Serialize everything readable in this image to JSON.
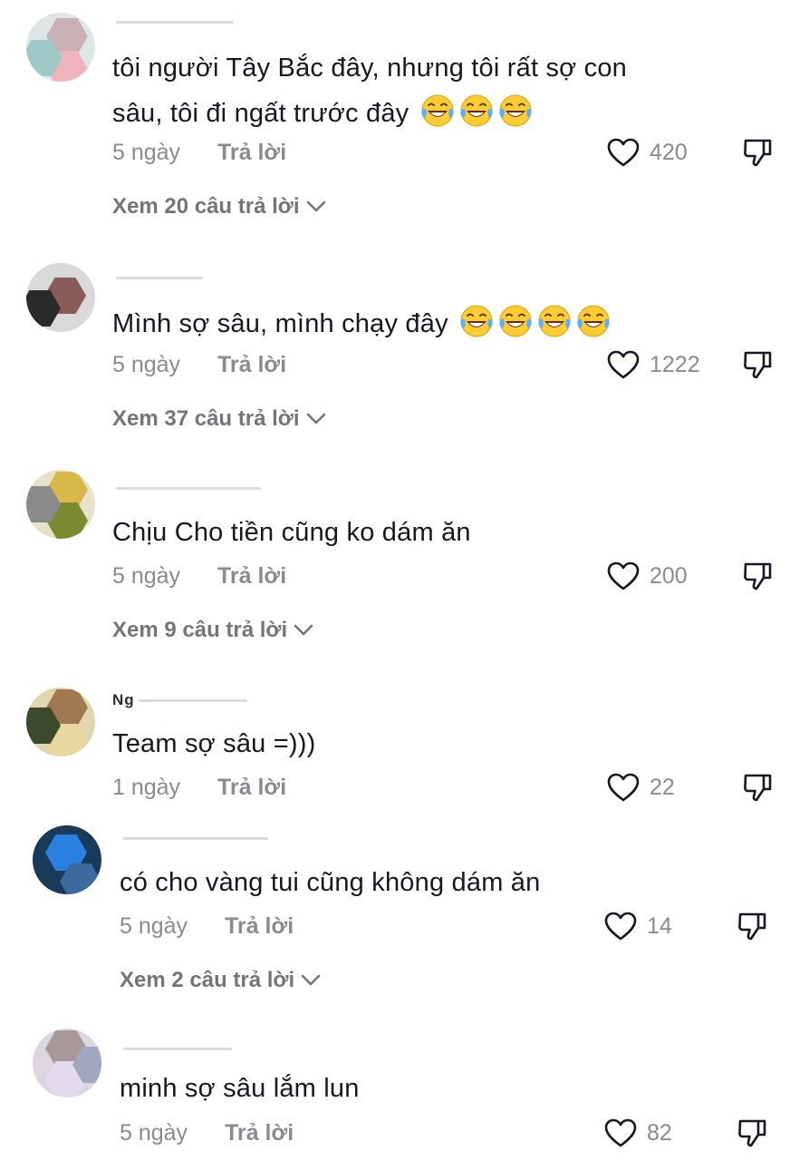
{
  "comments": [
    {
      "username": "",
      "text": "tôi người Tây Bắc đây, nhưng tôi rất sợ con",
      "text_line2": "sâu, tôi đi ngất trước đây",
      "emojis": 3,
      "date": "5 ngày",
      "reply_label": "Trả lời",
      "likes": "420",
      "view_replies": "Xem 20 câu trả lời"
    },
    {
      "username": "",
      "text": "Mình sợ sâu, mình chạy đây",
      "emojis": 4,
      "date": "5 ngày",
      "reply_label": "Trả lời",
      "likes": "1222",
      "view_replies": "Xem 37 câu trả lời"
    },
    {
      "username": "",
      "text": "Chịu Cho tiền cũng ko dám ăn",
      "emojis": 0,
      "date": "5 ngày",
      "reply_label": "Trả lời",
      "likes": "200",
      "view_replies": "Xem 9 câu trả lời"
    },
    {
      "username": "Ng",
      "text": "Team sợ sâu =)))",
      "emojis": 0,
      "date": "1 ngày",
      "reply_label": "Trả lời",
      "likes": "22",
      "view_replies": ""
    },
    {
      "username": "",
      "text": "có cho vàng tui cũng không dám ăn",
      "emojis": 0,
      "date": "5 ngày",
      "reply_label": "Trả lời",
      "likes": "14",
      "view_replies": "Xem 2 câu trả lời"
    },
    {
      "username": "",
      "text": "minh sợ sâu lắm lun",
      "emojis": 0,
      "date": "5 ngày",
      "reply_label": "Trả lời",
      "likes": "82",
      "view_replies": ""
    }
  ],
  "icons": {
    "like": "heart-outline-icon",
    "dislike": "thumbs-down-icon",
    "expand": "chevron-down-icon",
    "emoji": "face-with-tears-of-joy-icon"
  },
  "colors": {
    "text": "#161823",
    "muted": "#8a8b91",
    "replies": "#747579"
  }
}
